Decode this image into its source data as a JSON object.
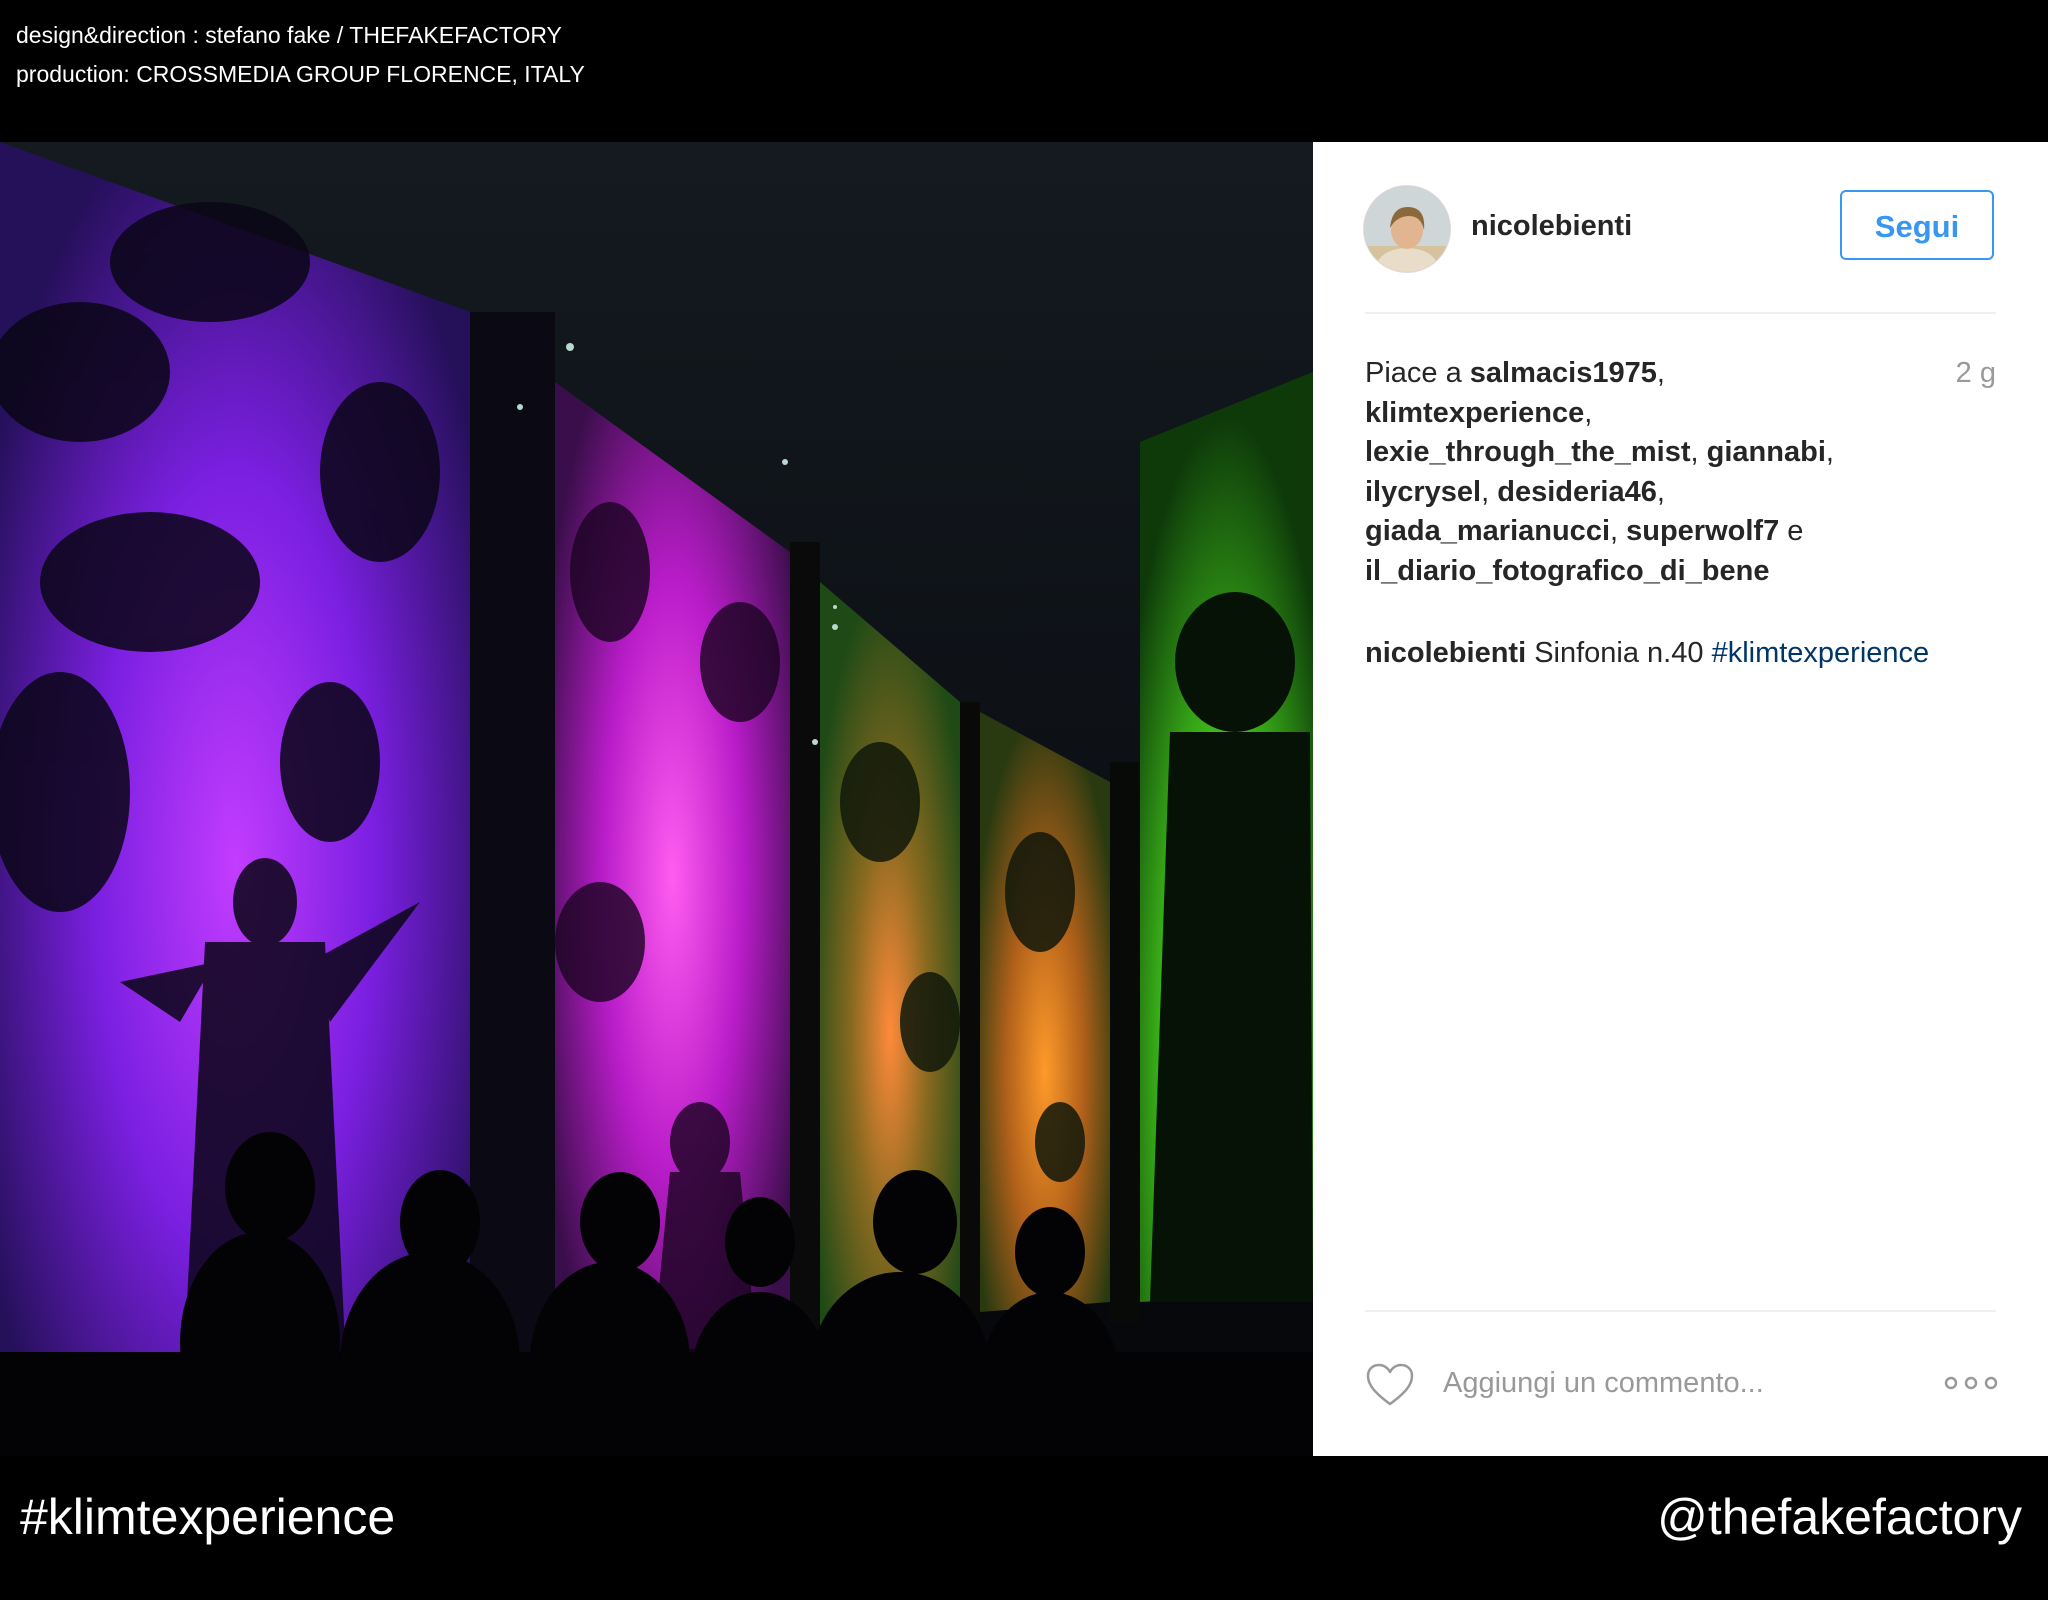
{
  "credits": {
    "line1": "design&direction : stefano fake / THEFAKEFACTORY",
    "line2": "production: CROSSMEDIA GROUP FLORENCE, ITALY"
  },
  "post": {
    "username": "nicolebienti",
    "follow_label": "Segui",
    "likes": {
      "prefix": "Piace a ",
      "users": [
        "salmacis1975",
        "klimtexperience",
        "lexie_through_the_mist",
        "giannabi",
        "ilycrysel",
        "desideria46",
        "giada_marianucci",
        "superwolf7",
        "il_diario_fotografico_di_bene"
      ],
      "conjunction": " e "
    },
    "time": "2 g",
    "caption": {
      "username": "nicolebienti",
      "text": " Sinfonia n.40 ",
      "hashtag": "#klimtexperience"
    },
    "comment_placeholder": "Aggiungi un commento...",
    "icons": {
      "like": "heart-icon",
      "more": "more-options-icon",
      "avatar": "profile-photo"
    }
  },
  "footer": {
    "hashtag": "#klimtexperience",
    "handle": "@thefakefactory"
  },
  "colors": {
    "link_blue": "#3897f0",
    "hashtag_blue": "#003569",
    "muted_gray": "#999999",
    "text_dark": "#262626"
  }
}
